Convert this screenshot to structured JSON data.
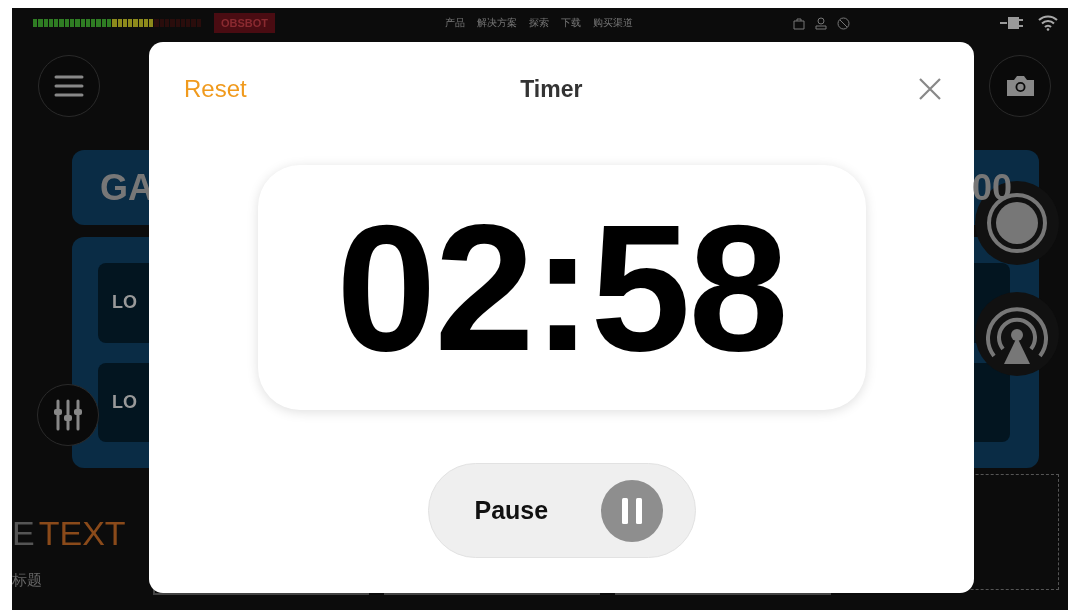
{
  "top_bar": {
    "audio_meter": {
      "level": 0.72
    },
    "brand_badge": "OBSBOT",
    "nav": [
      "产品",
      "解决方案",
      "探索",
      "下载",
      "购买渠道"
    ]
  },
  "cards": {
    "gain_label": "GA",
    "gain_value": "00",
    "rows": [
      "LO",
      "LO"
    ]
  },
  "bottom": {
    "heading_muted": "E",
    "heading_accent": "TEXT",
    "subtitle": "标题"
  },
  "timer_dialog": {
    "reset": "Reset",
    "title": "Timer",
    "time": "02:58",
    "action": {
      "label": "Pause",
      "running": true
    }
  }
}
